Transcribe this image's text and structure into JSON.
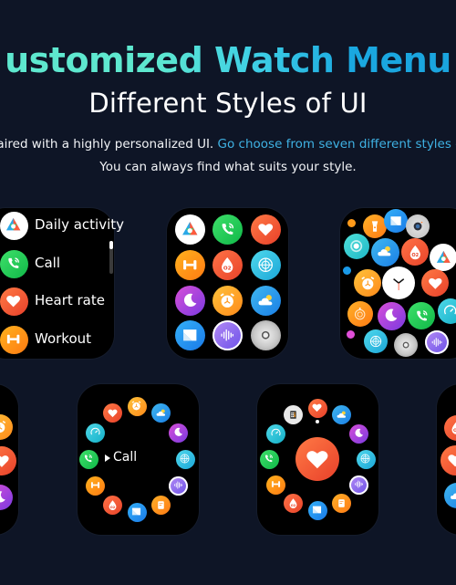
{
  "header": {
    "title": "ustomized Watch Menu",
    "subtitle": "Different Styles of UI",
    "description_line1_plain": "paired with a highly personalized UI. ",
    "description_line1_highlight": "Go choose from seven different styles of",
    "description_line2": "You can always find what suits your style."
  },
  "colors": {
    "background": "#0e1526",
    "title_gradient_start": "#5ee8cf",
    "title_gradient_end": "#1aa3de",
    "highlight_text": "#3fb2e4"
  },
  "styles": {
    "list_view": {
      "items": [
        {
          "label": "Daily activity",
          "icon": "activity-icon"
        },
        {
          "label": "Call",
          "icon": "phone-icon"
        },
        {
          "label": "Heart rate",
          "icon": "heart-icon"
        },
        {
          "label": "Workout",
          "icon": "dumbbell-icon"
        }
      ]
    },
    "grid_view": {
      "icons": [
        "activity-icon",
        "phone-icon",
        "heart-icon",
        "dumbbell-icon",
        "blood-oxygen-icon",
        "compass-icon",
        "moon-sleep-icon",
        "alarm-icon",
        "weather-icon",
        "message-icon",
        "voice-assistant-icon",
        "settings-icon"
      ]
    },
    "honeycomb_view": {
      "icons": [
        "flashlight-icon",
        "message-icon",
        "camera-icon",
        "breathe-icon",
        "weather-icon",
        "blood-oxygen-icon",
        "activity-icon",
        "alarm-icon",
        "clock-icon",
        "heart-icon",
        "stopwatch-icon",
        "moon-sleep-icon",
        "phone-icon",
        "speedometer-icon",
        "compass-icon",
        "settings-icon",
        "voice-assistant-icon"
      ]
    },
    "ring_call_view": {
      "center_label": "Call",
      "icons": [
        "alarm-icon",
        "weather-icon",
        "moon-sleep-icon",
        "compass-icon",
        "voice-assistant-icon",
        "notes-icon",
        "message-icon",
        "blood-oxygen-icon",
        "dumbbell-icon",
        "phone-icon",
        "speedometer-icon",
        "heart-icon"
      ]
    },
    "ring_heart_view": {
      "center_icon": "heart-icon",
      "icons": [
        "heart-icon",
        "weather-icon",
        "moon-sleep-icon",
        "compass-icon",
        "voice-assistant-icon",
        "notes-icon",
        "message-icon",
        "blood-oxygen-icon",
        "dumbbell-icon",
        "phone-icon",
        "speedometer-icon",
        "calculator-icon"
      ]
    }
  }
}
